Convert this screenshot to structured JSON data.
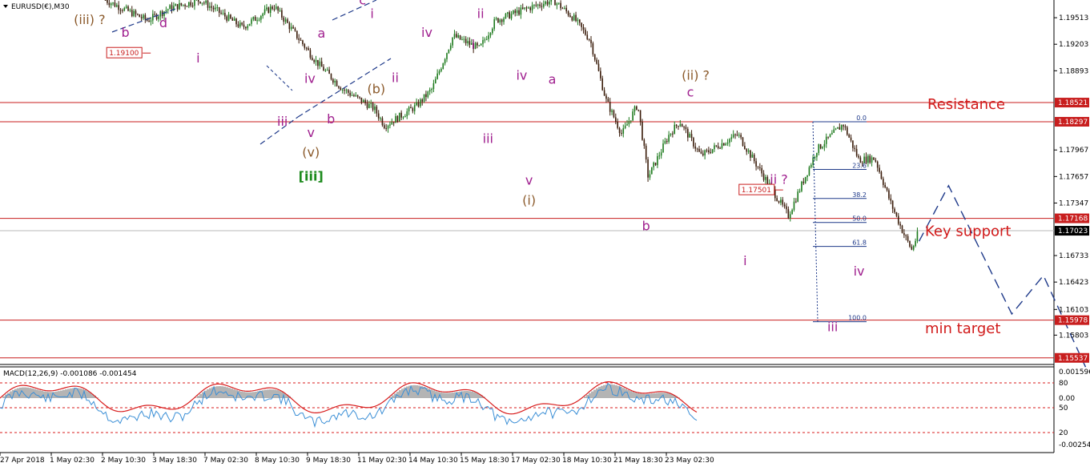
{
  "header": {
    "symbol": "EURUSD(€),M30"
  },
  "colors": {
    "candle": "#1d7a1d",
    "candle_down": "#3a1c0a",
    "level_line": "#c81e1e",
    "wave_magenta": "#a0208f",
    "wave_brown": "#8b5a2b",
    "wave_green": "#1c8a1c",
    "zone_text": "#d11a1a",
    "projection": "#1f3a8a",
    "macd_hist": "#b4b4b4",
    "macd_signal": "#d81e1e",
    "macd_line": "#3b8fd6"
  },
  "chart_data": [
    {
      "type": "candlestick",
      "symbol": "EURUSD",
      "timeframe": "M30",
      "ylim": [
        1.1546,
        1.1972
      ],
      "price_ticks": [
        {
          "value": 1.19513,
          "label": "1.19513"
        },
        {
          "value": 1.19203,
          "label": "1.19203"
        },
        {
          "value": 1.18893,
          "label": "1.18893"
        },
        {
          "value": 1.17967,
          "label": "1.17967"
        },
        {
          "value": 1.17657,
          "label": "1.17657"
        },
        {
          "value": 1.17347,
          "label": "1.17347"
        },
        {
          "value": 1.16733,
          "label": "1.16733"
        },
        {
          "value": 1.16423,
          "label": "1.16423"
        },
        {
          "value": 1.16103,
          "label": "1.16103"
        },
        {
          "value": 1.15803,
          "label": "1.15803"
        }
      ],
      "time_labels": [
        "27 Apr 2018",
        "1 May 02:30",
        "2 May 10:30",
        "3 May 18:30",
        "7 May 02:30",
        "8 May 10:30",
        "9 May 18:30",
        "11 May 02:30",
        "14 May 10:30",
        "15 May 18:30",
        "17 May 02:30",
        "18 May 10:30",
        "21 May 18:30",
        "23 May 02:30"
      ],
      "price_path": [
        {
          "t": 0.1,
          "p": 1.1972
        },
        {
          "t": 0.14,
          "p": 1.1948
        },
        {
          "t": 0.16,
          "p": 1.1962
        },
        {
          "t": 0.19,
          "p": 1.1972
        },
        {
          "t": 0.23,
          "p": 1.194
        },
        {
          "t": 0.26,
          "p": 1.1965
        },
        {
          "t": 0.3,
          "p": 1.19
        },
        {
          "t": 0.325,
          "p": 1.1868
        },
        {
          "t": 0.355,
          "p": 1.1845
        },
        {
          "t": 0.365,
          "p": 1.1825
        },
        {
          "t": 0.395,
          "p": 1.1848
        },
        {
          "t": 0.41,
          "p": 1.1868
        },
        {
          "t": 0.43,
          "p": 1.193
        },
        {
          "t": 0.455,
          "p": 1.1915
        },
        {
          "t": 0.47,
          "p": 1.1948
        },
        {
          "t": 0.5,
          "p": 1.1962
        },
        {
          "t": 0.525,
          "p": 1.1972
        },
        {
          "t": 0.545,
          "p": 1.195
        },
        {
          "t": 0.56,
          "p": 1.1925
        },
        {
          "t": 0.575,
          "p": 1.1855
        },
        {
          "t": 0.59,
          "p": 1.1815
        },
        {
          "t": 0.605,
          "p": 1.185
        },
        {
          "t": 0.615,
          "p": 1.1765
        },
        {
          "t": 0.635,
          "p": 1.1815
        },
        {
          "t": 0.645,
          "p": 1.183
        },
        {
          "t": 0.665,
          "p": 1.179
        },
        {
          "t": 0.7,
          "p": 1.1815
        },
        {
          "t": 0.72,
          "p": 1.1775
        },
        {
          "t": 0.748,
          "p": 1.172
        },
        {
          "t": 0.775,
          "p": 1.1797
        },
        {
          "t": 0.8,
          "p": 1.1827
        },
        {
          "t": 0.815,
          "p": 1.1785
        },
        {
          "t": 0.83,
          "p": 1.1787
        },
        {
          "t": 0.845,
          "p": 1.1735
        },
        {
          "t": 0.857,
          "p": 1.17
        },
        {
          "t": 0.865,
          "p": 1.168
        },
        {
          "t": 0.872,
          "p": 1.1702
        }
      ],
      "horizontal_levels": [
        {
          "value": 1.18521,
          "label": "1.18521"
        },
        {
          "value": 1.18297,
          "label": "1.18297"
        },
        {
          "value": 1.17168,
          "label": "1.17168"
        },
        {
          "value": 1.17023,
          "label": "1.17023",
          "current": true
        },
        {
          "value": 1.15978,
          "label": "1.15978"
        },
        {
          "value": 1.15537,
          "label": "1.15537"
        }
      ],
      "price_tags": [
        {
          "t": 0.143,
          "value": 1.191,
          "label": "1.19100"
        },
        {
          "t": 0.743,
          "value": 1.175,
          "label": "1.17501"
        }
      ],
      "zone_labels": [
        {
          "text": "Resistance",
          "value": 1.1851
        },
        {
          "text": "Key support",
          "value": 1.1703
        },
        {
          "text": "min target",
          "value": 1.1589
        }
      ],
      "fibonacci": {
        "levels": [
          {
            "ratio": "0.0",
            "value": 1.18297
          },
          {
            "ratio": "23.6",
            "value": 1.1774
          },
          {
            "ratio": "38.2",
            "value": 1.174
          },
          {
            "ratio": "50.0",
            "value": 1.1712
          },
          {
            "ratio": "61.8",
            "value": 1.1684
          },
          {
            "ratio": "100.0",
            "value": 1.1596
          }
        ]
      },
      "projection": [
        {
          "t": 0.872,
          "p": 1.169
        },
        {
          "t": 0.9,
          "p": 1.1755
        },
        {
          "t": 0.96,
          "p": 1.1605
        },
        {
          "t": 0.99,
          "p": 1.165
        },
        {
          "t": 1.03,
          "p": 1.1543
        }
      ],
      "wave_labels": [
        {
          "text": "v",
          "t": 0.073,
          "value": 1.1972,
          "color": "magenta"
        },
        {
          "text": "(iii) ?",
          "t": 0.085,
          "value": 1.1944,
          "color": "brown"
        },
        {
          "text": "b",
          "t": 0.119,
          "value": 1.1929,
          "color": "magenta"
        },
        {
          "text": "d",
          "t": 0.155,
          "value": 1.194,
          "color": "magenta"
        },
        {
          "text": "i",
          "t": 0.188,
          "value": 1.1899,
          "color": "magenta"
        },
        {
          "text": "a",
          "t": 0.305,
          "value": 1.1928,
          "color": "magenta"
        },
        {
          "text": "c",
          "t": 0.344,
          "value": 1.1967,
          "color": "magenta"
        },
        {
          "text": "i",
          "t": 0.353,
          "value": 1.1951,
          "color": "magenta"
        },
        {
          "text": "iv",
          "t": 0.405,
          "value": 1.1929,
          "color": "magenta"
        },
        {
          "text": "iv",
          "t": 0.294,
          "value": 1.1875,
          "color": "magenta"
        },
        {
          "text": "ii",
          "t": 0.375,
          "value": 1.1876,
          "color": "magenta"
        },
        {
          "text": "(b)",
          "t": 0.357,
          "value": 1.1863,
          "color": "brown"
        },
        {
          "text": "iii",
          "t": 0.268,
          "value": 1.1825,
          "color": "magenta"
        },
        {
          "text": "b",
          "t": 0.314,
          "value": 1.1828,
          "color": "magenta"
        },
        {
          "text": "v",
          "t": 0.295,
          "value": 1.1812,
          "color": "magenta"
        },
        {
          "text": "(v)",
          "t": 0.295,
          "value": 1.1789,
          "color": "brown"
        },
        {
          "text": "[iii]",
          "t": 0.295,
          "value": 1.1761,
          "color": "green"
        },
        {
          "text": "ii",
          "t": 0.456,
          "value": 1.1951,
          "color": "magenta"
        },
        {
          "text": "i",
          "t": 0.449,
          "value": 1.1915,
          "color": "magenta"
        },
        {
          "text": "iv",
          "t": 0.495,
          "value": 1.1879,
          "color": "magenta"
        },
        {
          "text": "iii",
          "t": 0.463,
          "value": 1.1805,
          "color": "magenta"
        },
        {
          "text": "a",
          "t": 0.524,
          "value": 1.1874,
          "color": "magenta"
        },
        {
          "text": "v",
          "t": 0.502,
          "value": 1.1756,
          "color": "magenta"
        },
        {
          "text": "(i)",
          "t": 0.502,
          "value": 1.1733,
          "color": "brown"
        },
        {
          "text": "(ii) ?",
          "t": 0.66,
          "value": 1.1879,
          "color": "brown"
        },
        {
          "text": "c",
          "t": 0.655,
          "value": 1.1859,
          "color": "magenta"
        },
        {
          "text": "b",
          "t": 0.613,
          "value": 1.1703,
          "color": "magenta"
        },
        {
          "text": "ii ?",
          "t": 0.739,
          "value": 1.1757,
          "color": "magenta"
        },
        {
          "text": "i",
          "t": 0.707,
          "value": 1.1662,
          "color": "magenta"
        },
        {
          "text": "iv",
          "t": 0.815,
          "value": 1.165,
          "color": "magenta"
        },
        {
          "text": "iii",
          "t": 0.79,
          "value": 1.1585,
          "color": "magenta"
        }
      ]
    },
    {
      "type": "line",
      "indicator": "MACD",
      "label": "MACD(12,26,9) -0.001086 -0.001454",
      "params": [
        12,
        26,
        9
      ],
      "value": -0.001086,
      "signal": -0.001454,
      "axis_ticks": [
        "0.001596",
        "80",
        "0.00",
        "50",
        "20",
        "-0.002543"
      ]
    }
  ]
}
